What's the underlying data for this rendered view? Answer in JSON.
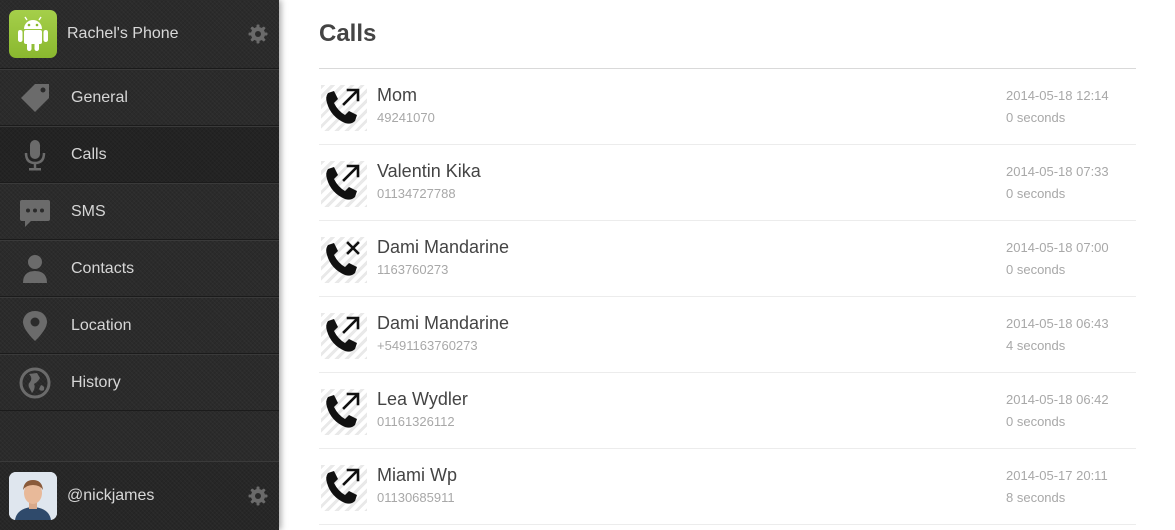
{
  "device": {
    "name": "Rachel's Phone",
    "logo_icon": "android-icon",
    "settings_icon": "gear-icon"
  },
  "nav": {
    "items": [
      {
        "label": "General",
        "icon": "tag-icon"
      },
      {
        "label": "Calls",
        "icon": "microphone-icon"
      },
      {
        "label": "SMS",
        "icon": "chat-bubble-icon"
      },
      {
        "label": "Contacts",
        "icon": "person-icon"
      },
      {
        "label": "Location",
        "icon": "map-pin-icon"
      },
      {
        "label": "History",
        "icon": "globe-icon"
      }
    ],
    "active": "Calls"
  },
  "user": {
    "handle": "@nickjames",
    "settings_icon": "gear-icon"
  },
  "page": {
    "title": "Calls"
  },
  "calls": [
    {
      "name": "Mom",
      "number": "49241070",
      "time": "2014-05-18 12:14",
      "duration": "0 seconds",
      "type": "outgoing"
    },
    {
      "name": "Valentin Kika",
      "number": "01134727788",
      "time": "2014-05-18 07:33",
      "duration": "0 seconds",
      "type": "outgoing"
    },
    {
      "name": "Dami Mandarine",
      "number": "1163760273",
      "time": "2014-05-18 07:00",
      "duration": "0 seconds",
      "type": "missed"
    },
    {
      "name": "Dami Mandarine",
      "number": "+5491163760273",
      "time": "2014-05-18 06:43",
      "duration": "4 seconds",
      "type": "outgoing"
    },
    {
      "name": "Lea Wydler",
      "number": "01161326112",
      "time": "2014-05-18 06:42",
      "duration": "0 seconds",
      "type": "outgoing"
    },
    {
      "name": "Miami Wp",
      "number": "01130685911",
      "time": "2014-05-17 20:11",
      "duration": "8 seconds",
      "type": "outgoing"
    }
  ],
  "colors": {
    "sidebar": "#2b2b2b",
    "android_green": "#a4c639",
    "text_dark": "#444444",
    "text_muted": "#a8a8a8"
  }
}
